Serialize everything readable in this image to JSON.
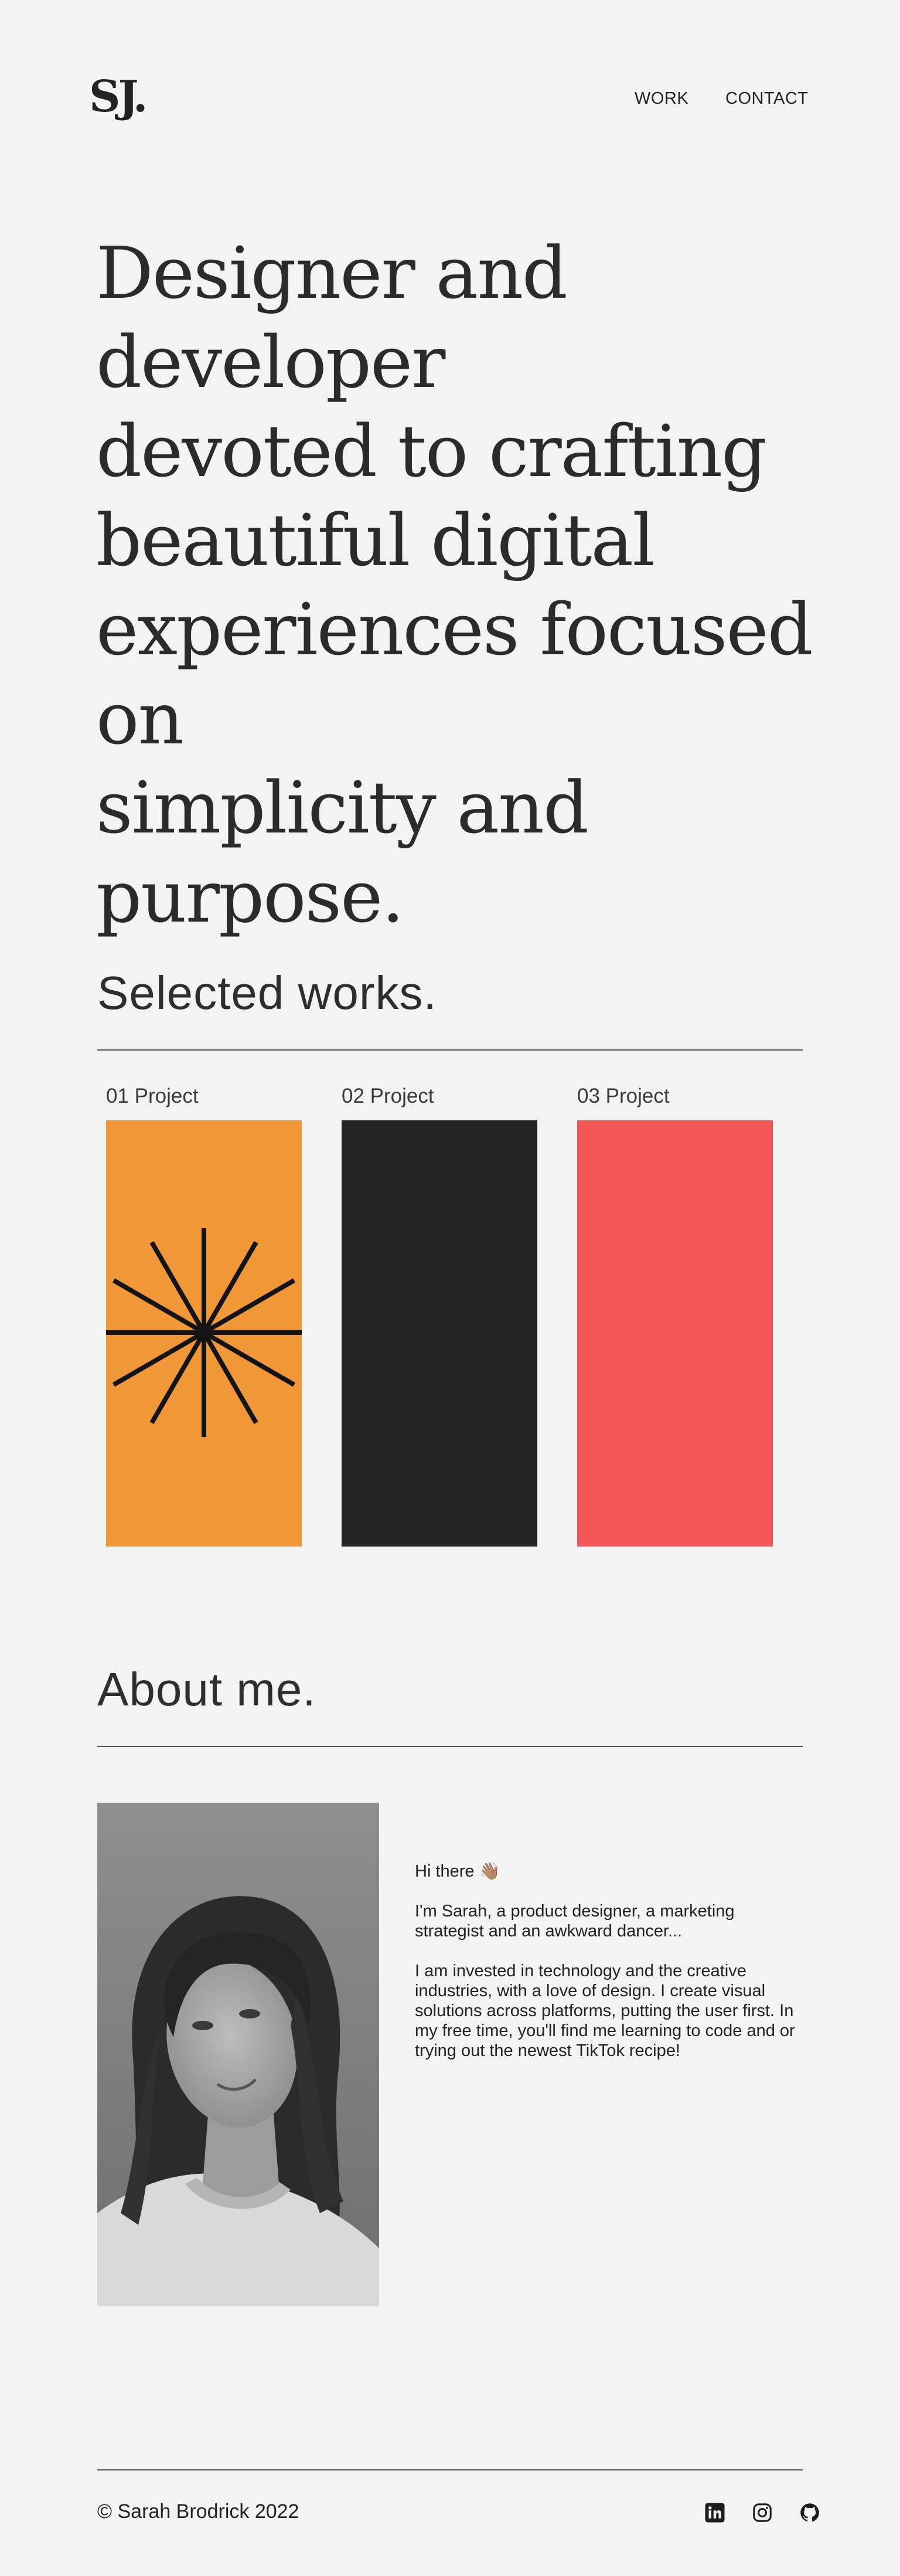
{
  "header": {
    "logo": "SJ.",
    "nav": [
      {
        "label": "WORK"
      },
      {
        "label": "CONTACT"
      }
    ]
  },
  "hero": {
    "line1": "Designer and developer",
    "line2": "devoted to crafting",
    "line3": "beautiful digital",
    "line4": "experiences focused on",
    "line5": "simplicity and purpose."
  },
  "works": {
    "title": "Selected works.",
    "projects": [
      {
        "label": "01 Project",
        "color": "#f09838"
      },
      {
        "label": "02 Project",
        "color": "#232323"
      },
      {
        "label": "03 Project",
        "color": "#f25656"
      }
    ]
  },
  "about": {
    "title": "About me.",
    "greeting": "Hi there 👋🏽",
    "paragraph1": "I'm Sarah, a product designer, a marketing strategist and an awkward dancer...",
    "paragraph2": "I am invested in technology and the creative industries, with a love of design. I create visual solutions across platforms, putting the user first. In my free time, you'll find me learning to code and or trying out the newest TikTok recipe!"
  },
  "footer": {
    "copyright": "© Sarah Brodrick 2022",
    "social": [
      "linkedin-icon",
      "instagram-icon",
      "github-icon"
    ]
  }
}
